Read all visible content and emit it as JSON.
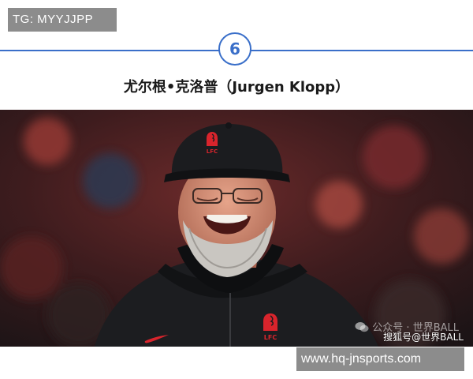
{
  "tg_label": "TG: MYYJJPP",
  "section_number": "6",
  "name_title": "尤尔根•克洛普（Jurgen Klopp）",
  "photo": {
    "cap_badge": "LFC",
    "jacket_badge": "LFC"
  },
  "watermarks": {
    "weixin": "公众号 · 世界BALL",
    "sohu": "搜狐号@世界BALL"
  },
  "site_url": "www.hq-jnsports.com",
  "colors": {
    "accent": "#3a6fc9",
    "tag_bg": "#8c8c8c",
    "badge_red": "#d8242c"
  }
}
